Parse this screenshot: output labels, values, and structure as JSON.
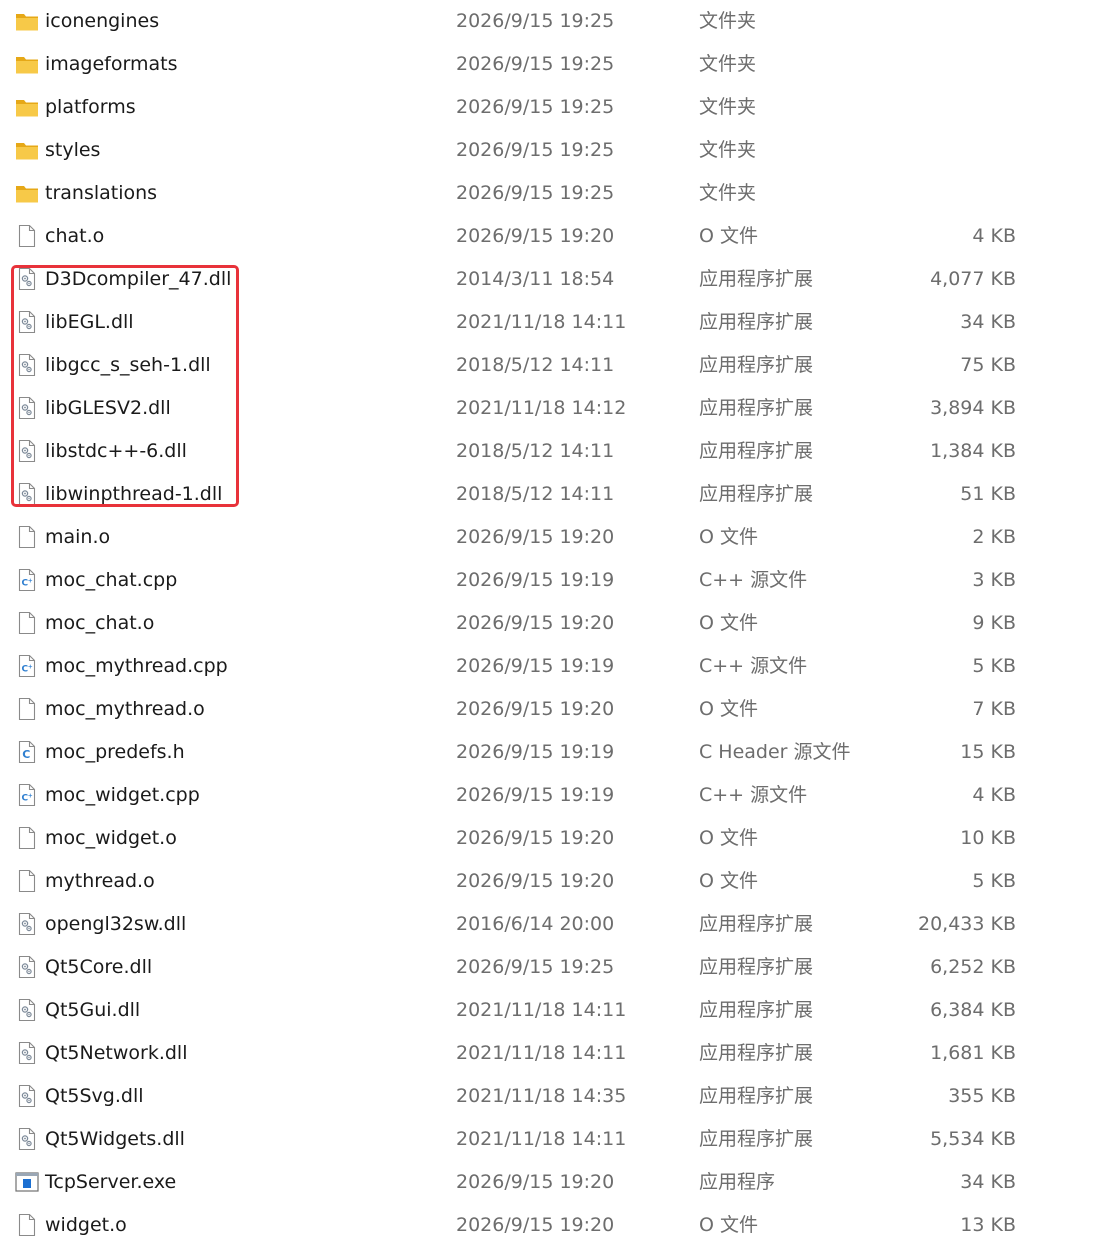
{
  "colors": {
    "folder": "#f7c948",
    "folder_dark": "#e6a817",
    "highlight_border": "#e8323a",
    "text_primary": "#1a1a1a",
    "text_secondary": "#6d6d6d",
    "cpp_icon_accent": "#2f7fd0",
    "exe_icon_accent": "#1b6fd1"
  },
  "files": [
    {
      "name": "iconengines",
      "date": "2026/9/15 19:25",
      "type": "文件夹",
      "size": "",
      "icon": "folder-icon"
    },
    {
      "name": "imageformats",
      "date": "2026/9/15 19:25",
      "type": "文件夹",
      "size": "",
      "icon": "folder-icon"
    },
    {
      "name": "platforms",
      "date": "2026/9/15 19:25",
      "type": "文件夹",
      "size": "",
      "icon": "folder-icon"
    },
    {
      "name": "styles",
      "date": "2026/9/15 19:25",
      "type": "文件夹",
      "size": "",
      "icon": "folder-icon"
    },
    {
      "name": "translations",
      "date": "2026/9/15 19:25",
      "type": "文件夹",
      "size": "",
      "icon": "folder-icon"
    },
    {
      "name": "chat.o",
      "date": "2026/9/15 19:20",
      "type": "O 文件",
      "size": "4 KB",
      "icon": "file-icon"
    },
    {
      "name": "D3Dcompiler_47.dll",
      "date": "2014/3/11 18:54",
      "type": "应用程序扩展",
      "size": "4,077 KB",
      "icon": "dll-icon"
    },
    {
      "name": "libEGL.dll",
      "date": "2021/11/18 14:11",
      "type": "应用程序扩展",
      "size": "34 KB",
      "icon": "dll-icon"
    },
    {
      "name": "libgcc_s_seh-1.dll",
      "date": "2018/5/12 14:11",
      "type": "应用程序扩展",
      "size": "75 KB",
      "icon": "dll-icon"
    },
    {
      "name": "libGLESV2.dll",
      "date": "2021/11/18 14:12",
      "type": "应用程序扩展",
      "size": "3,894 KB",
      "icon": "dll-icon"
    },
    {
      "name": "libstdc++-6.dll",
      "date": "2018/5/12 14:11",
      "type": "应用程序扩展",
      "size": "1,384 KB",
      "icon": "dll-icon"
    },
    {
      "name": "libwinpthread-1.dll",
      "date": "2018/5/12 14:11",
      "type": "应用程序扩展",
      "size": "51 KB",
      "icon": "dll-icon"
    },
    {
      "name": "main.o",
      "date": "2026/9/15 19:20",
      "type": "O 文件",
      "size": "2 KB",
      "icon": "file-icon"
    },
    {
      "name": "moc_chat.cpp",
      "date": "2026/9/15 19:19",
      "type": "C++ 源文件",
      "size": "3 KB",
      "icon": "cpp-file-icon"
    },
    {
      "name": "moc_chat.o",
      "date": "2026/9/15 19:20",
      "type": "O 文件",
      "size": "9 KB",
      "icon": "file-icon"
    },
    {
      "name": "moc_mythread.cpp",
      "date": "2026/9/15 19:19",
      "type": "C++ 源文件",
      "size": "5 KB",
      "icon": "cpp-file-icon"
    },
    {
      "name": "moc_mythread.o",
      "date": "2026/9/15 19:20",
      "type": "O 文件",
      "size": "7 KB",
      "icon": "file-icon"
    },
    {
      "name": "moc_predefs.h",
      "date": "2026/9/15 19:19",
      "type": "C Header 源文件",
      "size": "15 KB",
      "icon": "header-file-icon"
    },
    {
      "name": "moc_widget.cpp",
      "date": "2026/9/15 19:19",
      "type": "C++ 源文件",
      "size": "4 KB",
      "icon": "cpp-file-icon"
    },
    {
      "name": "moc_widget.o",
      "date": "2026/9/15 19:20",
      "type": "O 文件",
      "size": "10 KB",
      "icon": "file-icon"
    },
    {
      "name": "mythread.o",
      "date": "2026/9/15 19:20",
      "type": "O 文件",
      "size": "5 KB",
      "icon": "file-icon"
    },
    {
      "name": "opengl32sw.dll",
      "date": "2016/6/14 20:00",
      "type": "应用程序扩展",
      "size": "20,433 KB",
      "icon": "dll-icon"
    },
    {
      "name": "Qt5Core.dll",
      "date": "2026/9/15 19:25",
      "type": "应用程序扩展",
      "size": "6,252 KB",
      "icon": "dll-icon"
    },
    {
      "name": "Qt5Gui.dll",
      "date": "2021/11/18 14:11",
      "type": "应用程序扩展",
      "size": "6,384 KB",
      "icon": "dll-icon"
    },
    {
      "name": "Qt5Network.dll",
      "date": "2021/11/18 14:11",
      "type": "应用程序扩展",
      "size": "1,681 KB",
      "icon": "dll-icon"
    },
    {
      "name": "Qt5Svg.dll",
      "date": "2021/11/18 14:35",
      "type": "应用程序扩展",
      "size": "355 KB",
      "icon": "dll-icon"
    },
    {
      "name": "Qt5Widgets.dll",
      "date": "2021/11/18 14:11",
      "type": "应用程序扩展",
      "size": "5,534 KB",
      "icon": "dll-icon"
    },
    {
      "name": "TcpServer.exe",
      "date": "2026/9/15 19:20",
      "type": "应用程序",
      "size": "34 KB",
      "icon": "exe-icon"
    },
    {
      "name": "widget.o",
      "date": "2026/9/15 19:20",
      "type": "O 文件",
      "size": "13 KB",
      "icon": "file-icon"
    }
  ]
}
